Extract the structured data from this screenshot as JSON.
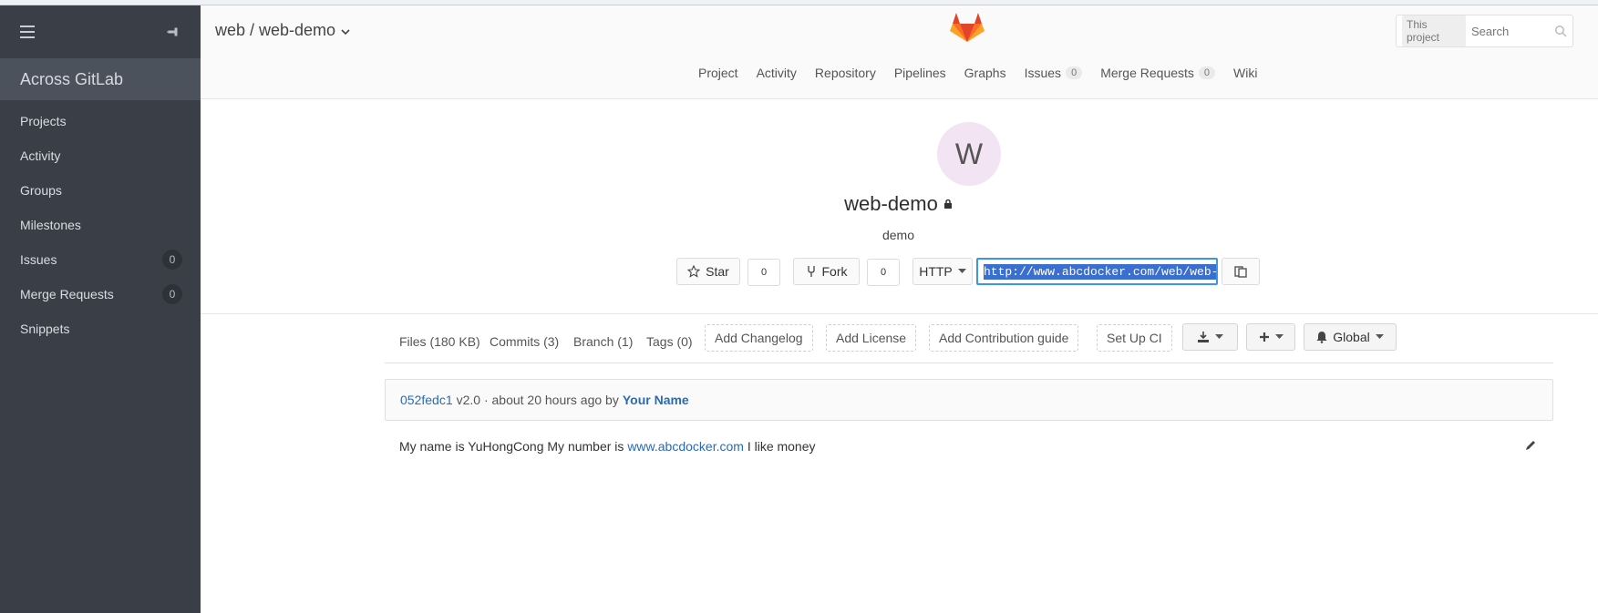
{
  "sidebar": {
    "brand": "Across GitLab",
    "items": [
      {
        "label": "Projects",
        "count": ""
      },
      {
        "label": "Activity",
        "count": ""
      },
      {
        "label": "Groups",
        "count": ""
      },
      {
        "label": "Milestones",
        "count": ""
      },
      {
        "label": "Issues",
        "count": "0"
      },
      {
        "label": "Merge Requests",
        "count": "0"
      },
      {
        "label": "Snippets",
        "count": ""
      }
    ]
  },
  "header": {
    "breadcrumb": "web / web-demo",
    "search": {
      "scope": "This project",
      "placeholder": "Search"
    },
    "nav": [
      {
        "label": "Project",
        "badge": ""
      },
      {
        "label": "Activity",
        "badge": ""
      },
      {
        "label": "Repository",
        "badge": ""
      },
      {
        "label": "Pipelines",
        "badge": ""
      },
      {
        "label": "Graphs",
        "badge": ""
      },
      {
        "label": "Issues",
        "badge": "0"
      },
      {
        "label": "Merge Requests",
        "badge": "0"
      },
      {
        "label": "Wiki",
        "badge": ""
      }
    ]
  },
  "project": {
    "avatar_letter": "W",
    "name": "web-demo",
    "description": "demo",
    "star_label": "Star",
    "star_count": "0",
    "fork_label": "Fork",
    "fork_count": "0",
    "protocol": "HTTP",
    "clone_url": "http://www.abcdocker.com/web/web-demo.git"
  },
  "stats": {
    "files": "Files (180 KB)",
    "commits": "Commits (3)",
    "branch": "Branch (1)",
    "tags": "Tags (0)",
    "add_changelog": "Add Changelog",
    "add_license": "Add License",
    "add_contribution": "Add Contribution guide",
    "setup_ci": "Set Up CI",
    "notification": "Global"
  },
  "commit": {
    "sha": "052fedc1",
    "message": "v2.0 · about 20 hours ago by",
    "author": "Your Name"
  },
  "readme": {
    "before": "My name is YuHongCong My number is",
    "link": "www.abcdocker.com",
    "after": "I like money"
  },
  "colors": {
    "sidebar": "#3a3f47",
    "link": "#2a6ab6",
    "accent": "#3b96e8"
  }
}
